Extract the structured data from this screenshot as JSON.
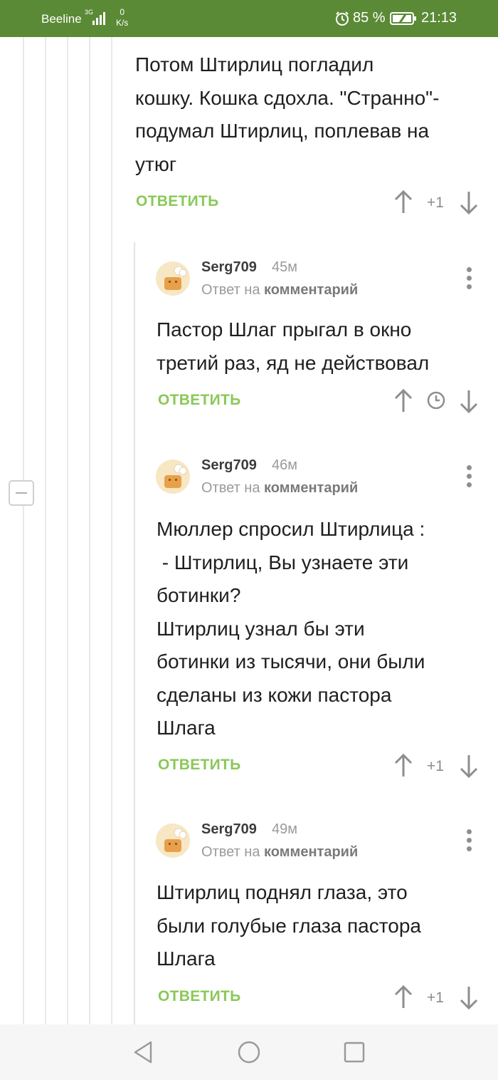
{
  "status_bar": {
    "carrier": "Beeline",
    "network": "3G",
    "speed_value": "0",
    "speed_unit": "K/s",
    "battery": "85 %",
    "time": "21:13"
  },
  "comments": [
    {
      "text": "Потом Штирлиц погладил\nкошку. Кошка сдохла. \"Странно\"-\nподумал Штирлиц, поплевав на\nутюг",
      "reply_label": "ОТВЕТИТЬ",
      "score": "+1"
    },
    {
      "author": "Serg709",
      "time": "45м",
      "reply_prefix": "Ответ на",
      "reply_target": "комментарий",
      "text": "Пастор Шлаг прыгал в окно\nтретий раз, яд не действовал",
      "reply_label": "ОТВЕТИТЬ",
      "score_icon": "clock-icon"
    },
    {
      "author": "Serg709",
      "time": "46м",
      "reply_prefix": "Ответ на",
      "reply_target": "комментарий",
      "text": "Мюллер спросил Штирлица :\n - Штирлиц, Вы узнаете эти\nботинки?\nШтирлиц узнал бы эти\nботинки из тысячи, они были\nсделаны из кожи пастора\nШлага",
      "reply_label": "ОТВЕТИТЬ",
      "score": "+1"
    },
    {
      "author": "Serg709",
      "time": "49м",
      "reply_prefix": "Ответ на",
      "reply_target": "комментарий",
      "text": "Штирлиц поднял глаза, это\nбыли голубые глаза пастора\nШлага",
      "reply_label": "ОТВЕТИТЬ",
      "score": "+1"
    }
  ],
  "nav_bar": {
    "icons": [
      "back-icon",
      "home-icon",
      "recents-icon"
    ]
  },
  "colors": {
    "status_bar": "#5a8a35",
    "reply_button": "#8ac858",
    "text": "#1f1f1f",
    "muted": "#9a9a9a"
  }
}
